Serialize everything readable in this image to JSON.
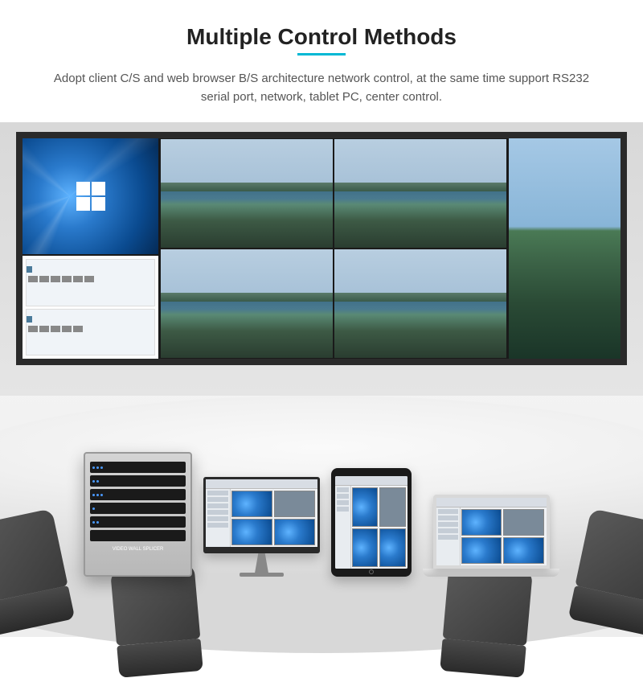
{
  "header": {
    "title": "Multiple Control Methods",
    "description": "Adopt client C/S and web browser B/S architecture network control, at the same time support RS232 serial port, network, tablet PC, center control."
  },
  "rack": {
    "label": "VIDEO WALL SPLICER"
  }
}
